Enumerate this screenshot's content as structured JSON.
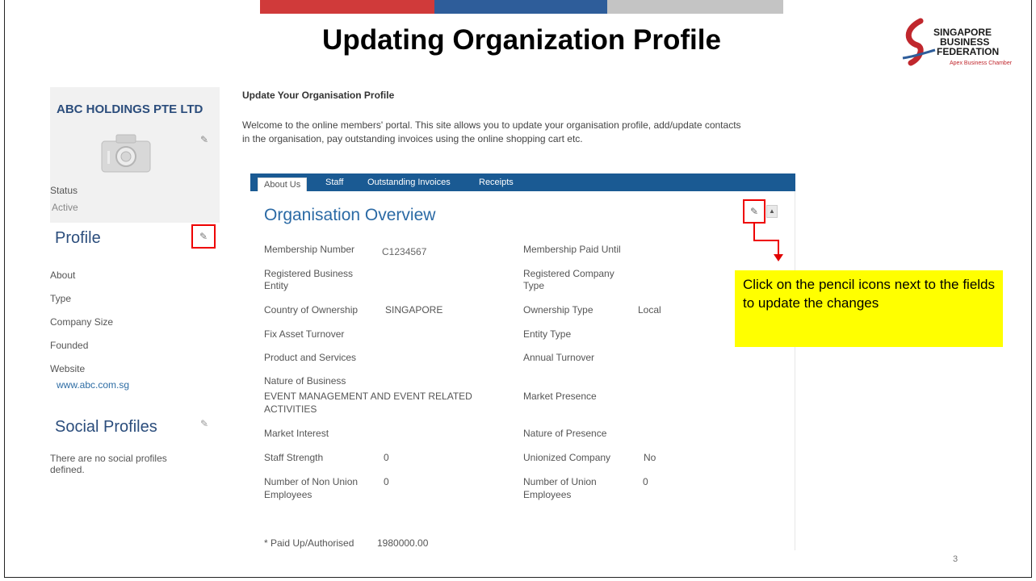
{
  "slide": {
    "title": "Updating Organization Profile",
    "page_number": "3"
  },
  "logo": {
    "line1": "SINGAPORE",
    "line2": "BUSINESS",
    "line3": "FEDERATION",
    "subtitle": "Apex Business Chamber"
  },
  "sidebar": {
    "company_name": "ABC HOLDINGS PTE LTD",
    "status_label": "Status",
    "status_value": "Active",
    "profile_heading": "Profile",
    "profile_items": [
      "About",
      "Type",
      "Company Size",
      "Founded",
      "Website"
    ],
    "website_url": "www.abc.com.sg",
    "social_heading": "Social Profiles",
    "social_empty_1": "There are no social profiles",
    "social_empty_2": "defined."
  },
  "main": {
    "heading": "Update Your Organisation Profile",
    "intro_line1": "Welcome to the online members' portal. This site allows you to update your organisation profile, add/update contacts",
    "intro_line2": "in the organisation, pay outstanding invoices using the online shopping cart etc.",
    "tabs": [
      "About Us",
      "Staff",
      "Outstanding Invoices",
      "Receipts"
    ],
    "overview_title": "Organisation Overview"
  },
  "fields": {
    "membership_number_label": "Membership Number",
    "membership_number_value": "C1234567",
    "membership_paid_until_label": "Membership Paid Until",
    "registered_business_entity_label_1": "Registered Business",
    "registered_business_entity_label_2": "Entity",
    "registered_company_type_label_1": "Registered Company",
    "registered_company_type_label_2": "Type",
    "country_of_ownership_label": "Country of Ownership",
    "country_of_ownership_value": "SINGAPORE",
    "ownership_type_label": "Ownership Type",
    "ownership_type_value": "Local",
    "fix_asset_turnover_label": "Fix Asset Turnover",
    "entity_type_label": "Entity Type",
    "product_and_services_label": "Product and Services",
    "annual_turnover_label": "Annual Turnover",
    "nature_of_business_label": "Nature of Business",
    "nature_of_business_value_1": "EVENT MANAGEMENT AND EVENT RELATED",
    "nature_of_business_value_2": "ACTIVITIES",
    "market_presence_label": "Market Presence",
    "market_interest_label": "Market Interest",
    "nature_of_presence_label": "Nature of Presence",
    "staff_strength_label": "Staff Strength",
    "staff_strength_value": "0",
    "unionized_company_label": "Unionized Company",
    "unionized_company_value": "No",
    "non_union_label_1": "Number of Non Union",
    "non_union_label_2": "Employees",
    "non_union_value": "0",
    "union_label_1": "Number of Union",
    "union_label_2": "Employees",
    "union_value": "0",
    "paid_up_label": "* Paid Up/Authorised",
    "paid_up_value": "1980000.00"
  },
  "callout": {
    "text": "Click on the pencil icons next to the fields to update the changes"
  },
  "icons": {
    "edit": "pencil-icon",
    "collapse": "triangle-up-icon",
    "photo": "camera-icon"
  },
  "colors": {
    "accent_blue": "#2b6aa5",
    "tab_bar": "#1a5a93",
    "highlight": "#ffff00",
    "annotation_red": "#e00000"
  }
}
